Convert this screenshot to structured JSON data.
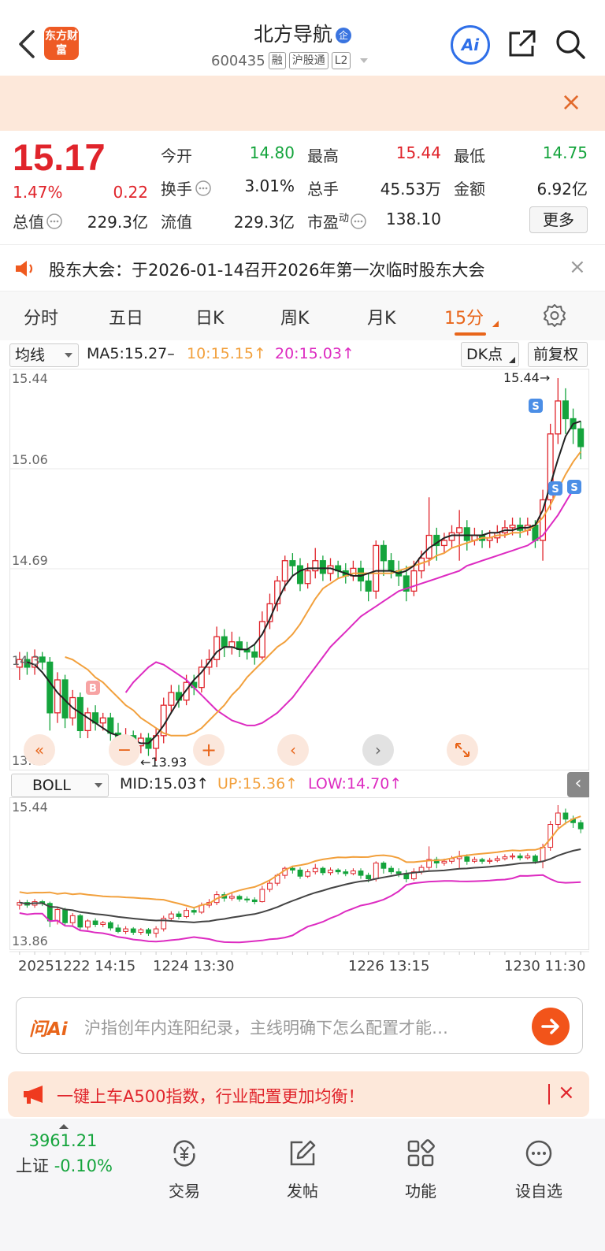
{
  "header": {
    "logo_text": "东方财富",
    "stock_name": "北方导航",
    "verify_badge": "企",
    "stock_code": "600435",
    "tags": [
      "融",
      "沪股通",
      "L2"
    ],
    "ai_label": "Ai"
  },
  "quote": {
    "price": "15.17",
    "change_pct": "1.47%",
    "change": "0.22",
    "rows": [
      [
        {
          "label": "今开",
          "value": "14.80",
          "color": "green"
        },
        {
          "label": "最高",
          "value": "15.44",
          "color": "red"
        },
        {
          "label": "最低",
          "value": "14.75",
          "color": "green"
        }
      ],
      [
        {
          "label": "换手",
          "value": "3.01%",
          "color": "dark"
        },
        {
          "label": "总手",
          "value": "45.53万",
          "color": "dark"
        },
        {
          "label": "金额",
          "value": "6.92亿",
          "color": "dark"
        }
      ]
    ],
    "total_value_label": "总值",
    "total_value": "229.3亿",
    "float_label": "流值",
    "float_value": "229.3亿",
    "pe_label": "市盈",
    "pe_sup": "动",
    "pe_value": "138.10",
    "more_label": "更多"
  },
  "notice": {
    "text": "股东大会：于2026-01-14召开2026年第一次临时股东大会"
  },
  "tabs": [
    "分时",
    "五日",
    "日K",
    "周K",
    "月K",
    "15分"
  ],
  "active_tab": 5,
  "ma_bar": {
    "selector": "均线",
    "ma5": "MA5:15.27–",
    "ma10": "10:15.15↑",
    "ma20": "20:15.03↑",
    "dk_label": "DK点",
    "adjust_label": "前复权"
  },
  "boll_bar": {
    "selector": "BOLL",
    "mid": "MID:15.03↑",
    "up": "UP:15.36↑",
    "low": "LOW:14.70↑"
  },
  "chart_data": {
    "type": "candlestick",
    "main_axis_labels": [
      "15.44",
      "15.06",
      "14.69",
      "14.3",
      "13.93"
    ],
    "high_annotation": "15.44",
    "low_annotation": "13.93",
    "signal_b": "B",
    "signal_s": "S",
    "sub_axis_labels": [
      "15.44",
      "13.86"
    ],
    "x_labels": [
      "20251222 14:15",
      "1224 13:30",
      "1226 13:15",
      "1230 11:30"
    ],
    "ylim": [
      13.93,
      15.44
    ],
    "candles": [
      [
        14.3,
        14.33,
        14.25,
        14.36
      ],
      [
        14.33,
        14.3,
        14.27,
        14.36
      ],
      [
        14.3,
        14.34,
        14.27,
        14.37
      ],
      [
        14.34,
        14.32,
        14.29,
        14.36
      ],
      [
        14.32,
        14.12,
        14.05,
        14.34
      ],
      [
        14.12,
        14.25,
        14.08,
        14.28
      ],
      [
        14.25,
        14.1,
        14.06,
        14.27
      ],
      [
        14.1,
        14.18,
        14.07,
        14.21
      ],
      [
        14.18,
        14.05,
        14.02,
        14.2
      ],
      [
        14.05,
        14.12,
        14.02,
        14.14
      ],
      [
        14.12,
        14.08,
        14.05,
        14.15
      ],
      [
        14.08,
        14.1,
        14.05,
        14.12
      ],
      [
        14.1,
        14.04,
        14.01,
        14.12
      ],
      [
        14.04,
        14.0,
        13.98,
        14.08
      ],
      [
        14.0,
        14.03,
        13.97,
        14.06
      ],
      [
        14.03,
        13.99,
        13.96,
        14.05
      ],
      [
        13.99,
        14.02,
        13.96,
        14.04
      ],
      [
        14.02,
        13.98,
        13.95,
        14.04
      ],
      [
        13.98,
        14.03,
        13.93,
        14.06
      ],
      [
        14.03,
        14.15,
        14.0,
        14.18
      ],
      [
        14.15,
        14.2,
        14.12,
        14.23
      ],
      [
        14.2,
        14.17,
        14.14,
        14.23
      ],
      [
        14.17,
        14.24,
        14.15,
        14.27
      ],
      [
        14.24,
        14.22,
        14.19,
        14.27
      ],
      [
        14.22,
        14.3,
        14.2,
        14.33
      ],
      [
        14.3,
        14.33,
        14.27,
        14.37
      ],
      [
        14.33,
        14.42,
        14.3,
        14.46
      ],
      [
        14.42,
        14.38,
        14.34,
        14.45
      ],
      [
        14.38,
        14.4,
        14.35,
        14.44
      ],
      [
        14.4,
        14.37,
        14.34,
        14.42
      ],
      [
        14.37,
        14.36,
        14.33,
        14.4
      ],
      [
        14.36,
        14.34,
        14.31,
        14.39
      ],
      [
        14.34,
        14.48,
        14.33,
        14.52
      ],
      [
        14.48,
        14.55,
        14.45,
        14.59
      ],
      [
        14.55,
        14.64,
        14.52,
        14.66
      ],
      [
        14.64,
        14.72,
        14.6,
        14.74
      ],
      [
        14.72,
        14.7,
        14.66,
        14.75
      ],
      [
        14.7,
        14.63,
        14.6,
        14.73
      ],
      [
        14.63,
        14.68,
        14.61,
        14.71
      ],
      [
        14.68,
        14.72,
        14.65,
        14.77
      ],
      [
        14.72,
        14.67,
        14.64,
        14.74
      ],
      [
        14.67,
        14.7,
        14.64,
        14.73
      ],
      [
        14.7,
        14.68,
        14.65,
        14.72
      ],
      [
        14.68,
        14.66,
        14.63,
        14.71
      ],
      [
        14.66,
        14.69,
        14.64,
        14.72
      ],
      [
        14.69,
        14.64,
        14.6,
        14.72
      ],
      [
        14.64,
        14.6,
        14.56,
        14.67
      ],
      [
        14.6,
        14.78,
        14.57,
        14.8
      ],
      [
        14.78,
        14.72,
        14.66,
        14.8
      ],
      [
        14.72,
        14.68,
        14.65,
        14.75
      ],
      [
        14.68,
        14.66,
        14.62,
        14.72
      ],
      [
        14.66,
        14.6,
        14.56,
        14.7
      ],
      [
        14.6,
        14.68,
        14.58,
        14.72
      ],
      [
        14.68,
        14.73,
        14.65,
        14.76
      ],
      [
        14.73,
        14.82,
        14.7,
        14.97
      ],
      [
        14.82,
        14.78,
        14.72,
        14.85
      ],
      [
        14.78,
        14.8,
        14.75,
        14.83
      ],
      [
        14.8,
        14.83,
        14.77,
        14.86
      ],
      [
        14.83,
        14.85,
        14.72,
        14.92
      ],
      [
        14.85,
        14.8,
        14.76,
        14.88
      ],
      [
        14.8,
        14.82,
        14.78,
        14.85
      ],
      [
        14.82,
        14.8,
        14.77,
        14.84
      ],
      [
        14.8,
        14.81,
        14.77,
        14.84
      ],
      [
        14.81,
        14.83,
        14.79,
        14.86
      ],
      [
        14.83,
        14.85,
        14.81,
        14.88
      ],
      [
        14.85,
        14.86,
        14.82,
        14.89
      ],
      [
        14.86,
        14.84,
        14.81,
        14.89
      ],
      [
        14.84,
        14.86,
        14.82,
        14.89
      ],
      [
        14.86,
        14.8,
        14.77,
        14.88
      ],
      [
        14.8,
        14.96,
        14.72,
        15.0
      ],
      [
        14.96,
        15.22,
        14.92,
        15.26
      ],
      [
        15.22,
        15.35,
        15.18,
        15.44
      ],
      [
        15.35,
        15.28,
        15.22,
        15.4
      ],
      [
        15.28,
        15.24,
        15.18,
        15.32
      ],
      [
        15.24,
        15.17,
        15.12,
        15.27
      ]
    ],
    "ma5": [
      14.32,
      14.31,
      14.28,
      14.24,
      14.2,
      14.17,
      14.14,
      14.12,
      14.1,
      14.08,
      14.06,
      14.04,
      14.03,
      14.02,
      14.01,
      14.0,
      14.0,
      14.03,
      14.07,
      14.12,
      14.17,
      14.21,
      14.25,
      14.28,
      14.32,
      14.36,
      14.38,
      14.38,
      14.37,
      14.37,
      14.39,
      14.43,
      14.49,
      14.56,
      14.62,
      14.66,
      14.68,
      14.69,
      14.69,
      14.69,
      14.69,
      14.68,
      14.67,
      14.66,
      14.66,
      14.67,
      14.68,
      14.68,
      14.68,
      14.67,
      14.68,
      14.7,
      14.74,
      14.77,
      14.79,
      14.81,
      14.82,
      14.82,
      14.82,
      14.82,
      14.82,
      14.83,
      14.83,
      14.84,
      14.84,
      14.85,
      14.85,
      14.86,
      14.92,
      15.02,
      15.12,
      15.21,
      15.26,
      15.27
    ],
    "ma10": [
      14.34,
      14.33,
      14.31,
      14.29,
      14.26,
      14.24,
      14.21,
      14.18,
      14.15,
      14.13,
      14.1,
      14.08,
      14.06,
      14.04,
      14.03,
      14.03,
      14.03,
      14.04,
      14.06,
      14.09,
      14.12,
      14.15,
      14.19,
      14.22,
      14.26,
      14.29,
      14.32,
      14.35,
      14.38,
      14.4,
      14.43,
      14.47,
      14.52,
      14.57,
      14.61,
      14.63,
      14.65,
      14.66,
      14.67,
      14.67,
      14.67,
      14.67,
      14.67,
      14.67,
      14.68,
      14.69,
      14.7,
      14.71,
      14.72,
      14.74,
      14.75,
      14.77,
      14.78,
      14.79,
      14.8,
      14.81,
      14.81,
      14.82,
      14.82,
      14.83,
      14.83,
      14.84,
      14.86,
      14.89,
      14.94,
      15.0,
      15.06,
      15.11,
      15.15
    ],
    "ma20": [
      14.2,
      14.24,
      14.27,
      14.3,
      14.32,
      14.31,
      14.29,
      14.27,
      14.25,
      14.22,
      14.19,
      14.16,
      14.13,
      14.11,
      14.09,
      14.08,
      14.07,
      14.07,
      14.08,
      14.1,
      14.12,
      14.15,
      14.18,
      14.22,
      14.26,
      14.3,
      14.34,
      14.38,
      14.41,
      14.44,
      14.47,
      14.5,
      14.52,
      14.54,
      14.56,
      14.58,
      14.6,
      14.61,
      14.62,
      14.63,
      14.64,
      14.65,
      14.66,
      14.67,
      14.68,
      14.7,
      14.71,
      14.72,
      14.73,
      14.74,
      14.75,
      14.76,
      14.77,
      14.78,
      14.8,
      14.82,
      14.86,
      14.9,
      14.95,
      15.0,
      15.03
    ]
  },
  "ai_bar": {
    "logo": "问Ai",
    "text": "沪指创年内连阳纪录，主线明确下怎么配置才能…"
  },
  "promo": {
    "text": "一键上车A500指数，行业配置更加均衡！"
  },
  "navbar": {
    "index_value": "3961.21",
    "index_name": "上证",
    "index_change": "-0.10%",
    "items": [
      "交易",
      "发帖",
      "功能",
      "设自选"
    ]
  }
}
